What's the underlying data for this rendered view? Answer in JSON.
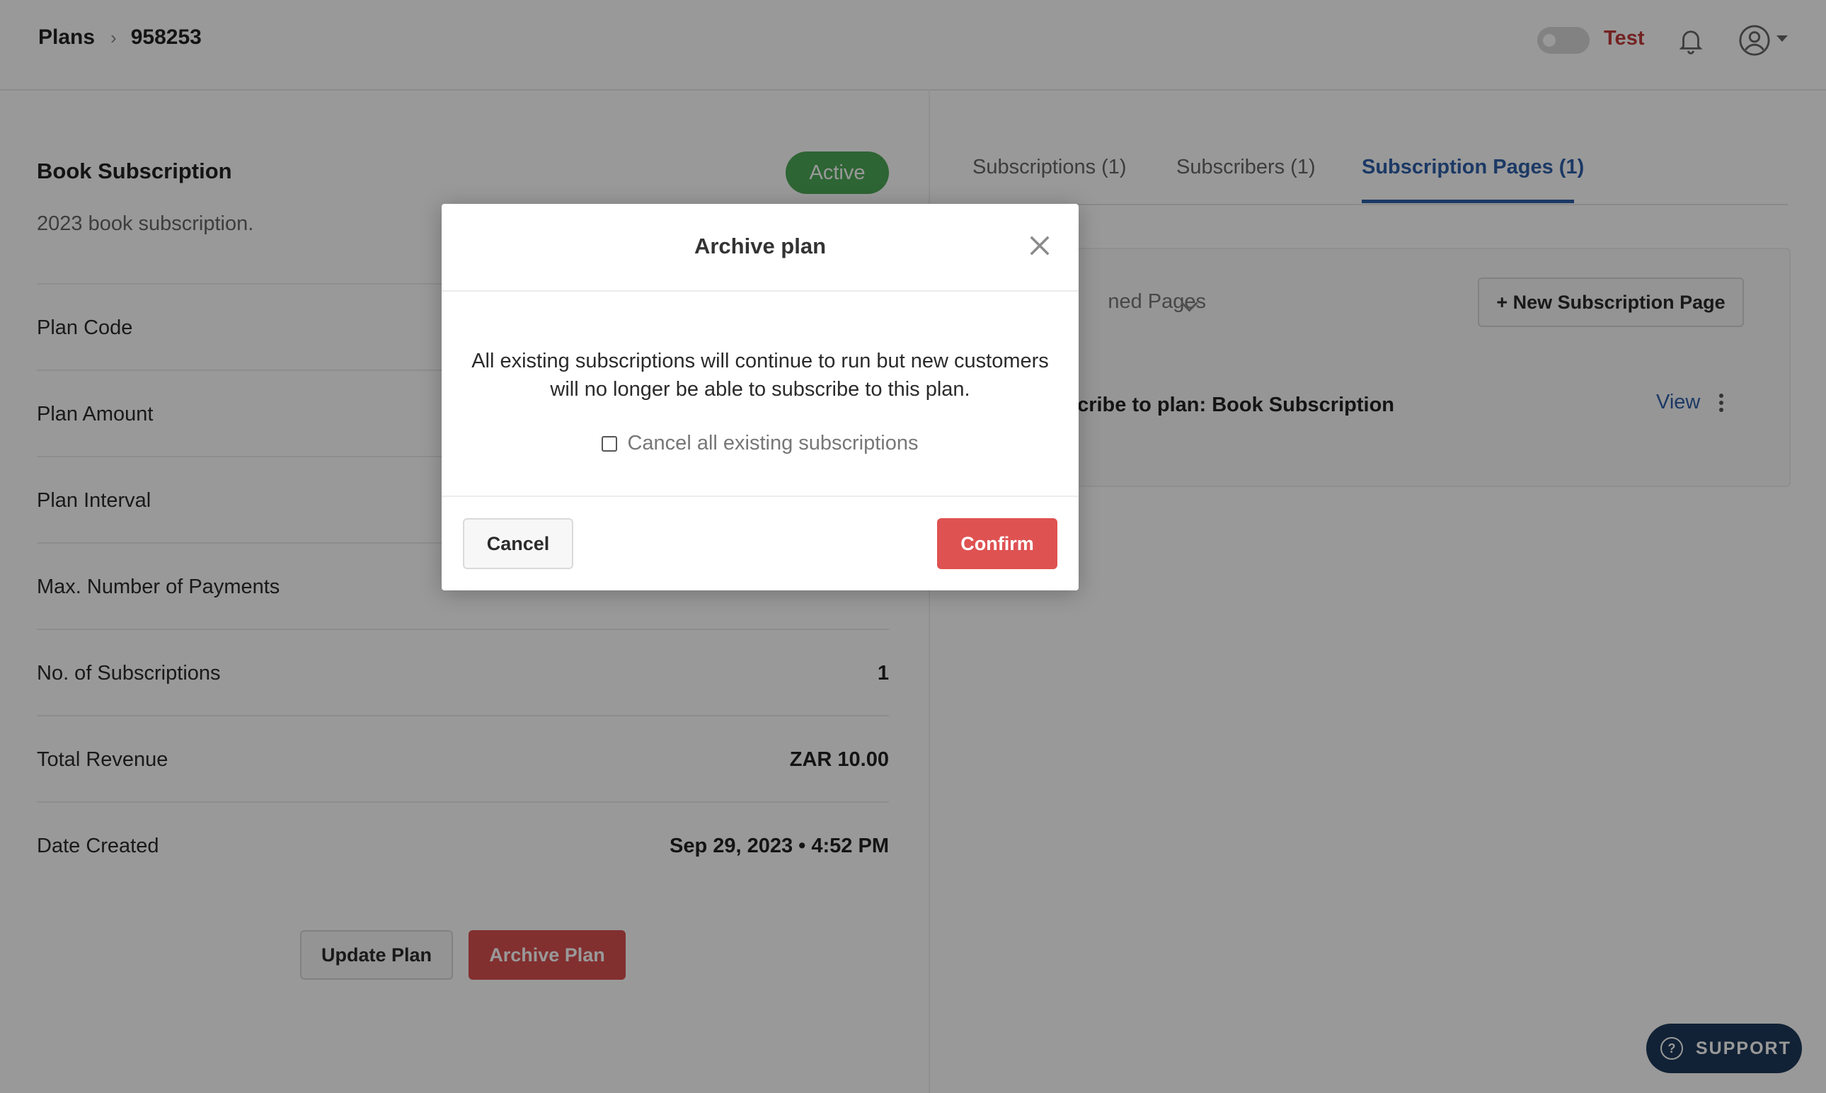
{
  "header": {
    "breadcrumb": [
      "Plans",
      "958253"
    ],
    "mode_label": "Test"
  },
  "plan": {
    "name": "Book Subscription",
    "status": "Active",
    "description": "2023 book subscription.",
    "details": [
      {
        "label": "Plan Code",
        "value": ""
      },
      {
        "label": "Plan Amount",
        "value": ""
      },
      {
        "label": "Plan Interval",
        "value": ""
      },
      {
        "label": "Max. Number of Payments",
        "value": ""
      },
      {
        "label": "No. of Subscriptions",
        "value": "1"
      },
      {
        "label": "Total Revenue",
        "value": "ZAR 10.00"
      },
      {
        "label": "Date Created",
        "value": "Sep 29, 2023 • 4:52 PM"
      }
    ],
    "update_button": "Update Plan",
    "archive_button": "Archive Plan"
  },
  "tabs": [
    {
      "label": "Subscriptions (1)",
      "active": false
    },
    {
      "label": "Subscribers (1)",
      "active": false
    },
    {
      "label": "Subscription Pages (1)",
      "active": true
    }
  ],
  "subscription_pages": {
    "filter_label": "ned Pages",
    "new_button": "+ New Subscription Page",
    "items": [
      {
        "title": "scribe to plan: Book Subscription",
        "action": "View"
      }
    ]
  },
  "support_label": "SUPPORT",
  "modal": {
    "title": "Archive plan",
    "message": "All existing subscriptions will continue to run but new customers will no longer be able to subscribe to this plan.",
    "checkbox_label": "Cancel all existing subscriptions",
    "checkbox_checked": false,
    "cancel_button": "Cancel",
    "confirm_button": "Confirm"
  },
  "colors": {
    "active_badge": "#4ea958",
    "archive": "#d94f4f",
    "link": "#2d5fa8",
    "test_label": "#c13a3a",
    "support": "#1e3a5a"
  },
  "icons": [
    "bell-icon",
    "user-avatar-icon",
    "close-icon",
    "chevron-down-icon",
    "kebab-icon",
    "help-icon"
  ]
}
